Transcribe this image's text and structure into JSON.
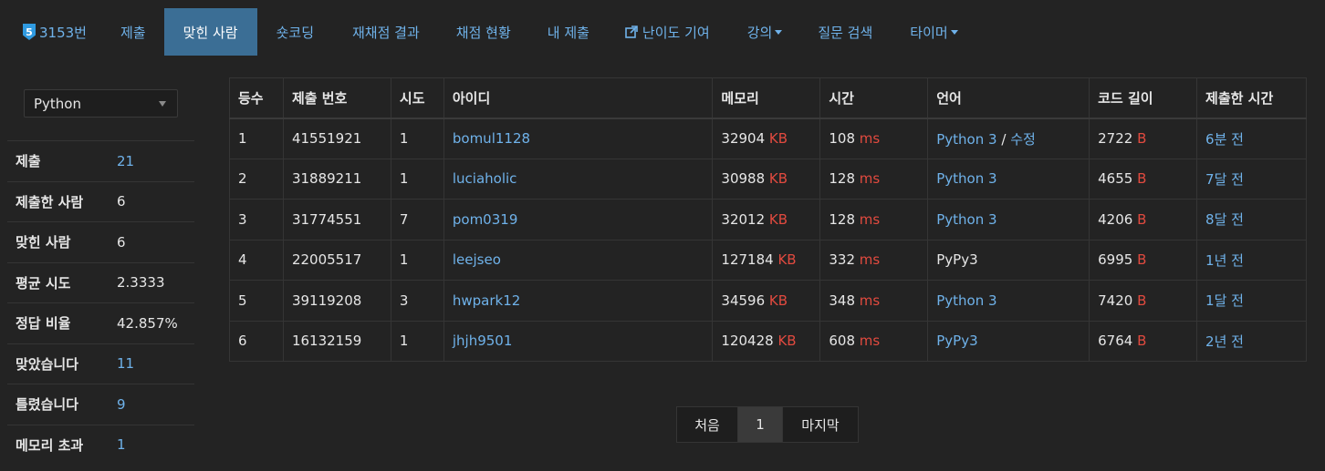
{
  "nav": {
    "problem_badge": "5",
    "problem_number": "3153번",
    "items": [
      {
        "label": "제출"
      },
      {
        "label": "맞힌 사람"
      },
      {
        "label": "숏코딩"
      },
      {
        "label": "재채점 결과"
      },
      {
        "label": "채점 현황"
      },
      {
        "label": "내 제출"
      },
      {
        "label": "난이도 기여"
      },
      {
        "label": "강의"
      },
      {
        "label": "질문 검색"
      },
      {
        "label": "타이머"
      }
    ]
  },
  "language_select": {
    "value": "Python"
  },
  "stats": [
    {
      "label": "제출",
      "value": "21"
    },
    {
      "label": "제출한 사람",
      "value": "6"
    },
    {
      "label": "맞힌 사람",
      "value": "6"
    },
    {
      "label": "평균 시도",
      "value": "2.3333"
    },
    {
      "label": "정답 비율",
      "value": "42.857%"
    },
    {
      "label": "맞았습니다",
      "value": "11"
    },
    {
      "label": "틀렸습니다",
      "value": "9"
    },
    {
      "label": "메모리 초과",
      "value": "1"
    }
  ],
  "table": {
    "headers": [
      "등수",
      "제출 번호",
      "시도",
      "아이디",
      "메모리",
      "시간",
      "언어",
      "코드 길이",
      "제출한 시간"
    ],
    "units": {
      "memory": "KB",
      "time": "ms",
      "length": "B"
    },
    "edit_label": "수정",
    "edit_sep": "/",
    "rows": [
      {
        "rank": "1",
        "submission": "41551921",
        "attempts": "1",
        "user": "bomul1128",
        "memory": "32904",
        "time": "108",
        "language": "Python 3",
        "length": "2722",
        "submitted": "6분 전"
      },
      {
        "rank": "2",
        "submission": "31889211",
        "attempts": "1",
        "user": "luciaholic",
        "memory": "30988",
        "time": "128",
        "language": "Python 3",
        "length": "4655",
        "submitted": "7달 전"
      },
      {
        "rank": "3",
        "submission": "31774551",
        "attempts": "7",
        "user": "pom0319",
        "memory": "32012",
        "time": "128",
        "language": "Python 3",
        "length": "4206",
        "submitted": "8달 전"
      },
      {
        "rank": "4",
        "submission": "22005517",
        "attempts": "1",
        "user": "leejseo",
        "memory": "127184",
        "time": "332",
        "language": "PyPy3",
        "length": "6995",
        "submitted": "1년 전"
      },
      {
        "rank": "5",
        "submission": "39119208",
        "attempts": "3",
        "user": "hwpark12",
        "memory": "34596",
        "time": "348",
        "language": "Python 3",
        "length": "7420",
        "submitted": "1달 전"
      },
      {
        "rank": "6",
        "submission": "16132159",
        "attempts": "1",
        "user": "jhjh9501",
        "memory": "120428",
        "time": "608",
        "language": "PyPy3",
        "length": "6764",
        "submitted": "2년 전"
      }
    ]
  },
  "pagination": {
    "first": "처음",
    "current": "1",
    "last": "마지막"
  },
  "colors": {
    "link": "#6fb2ea",
    "unit": "#e24a3f",
    "active_tab": "#3b6e95",
    "background": "#232323"
  }
}
